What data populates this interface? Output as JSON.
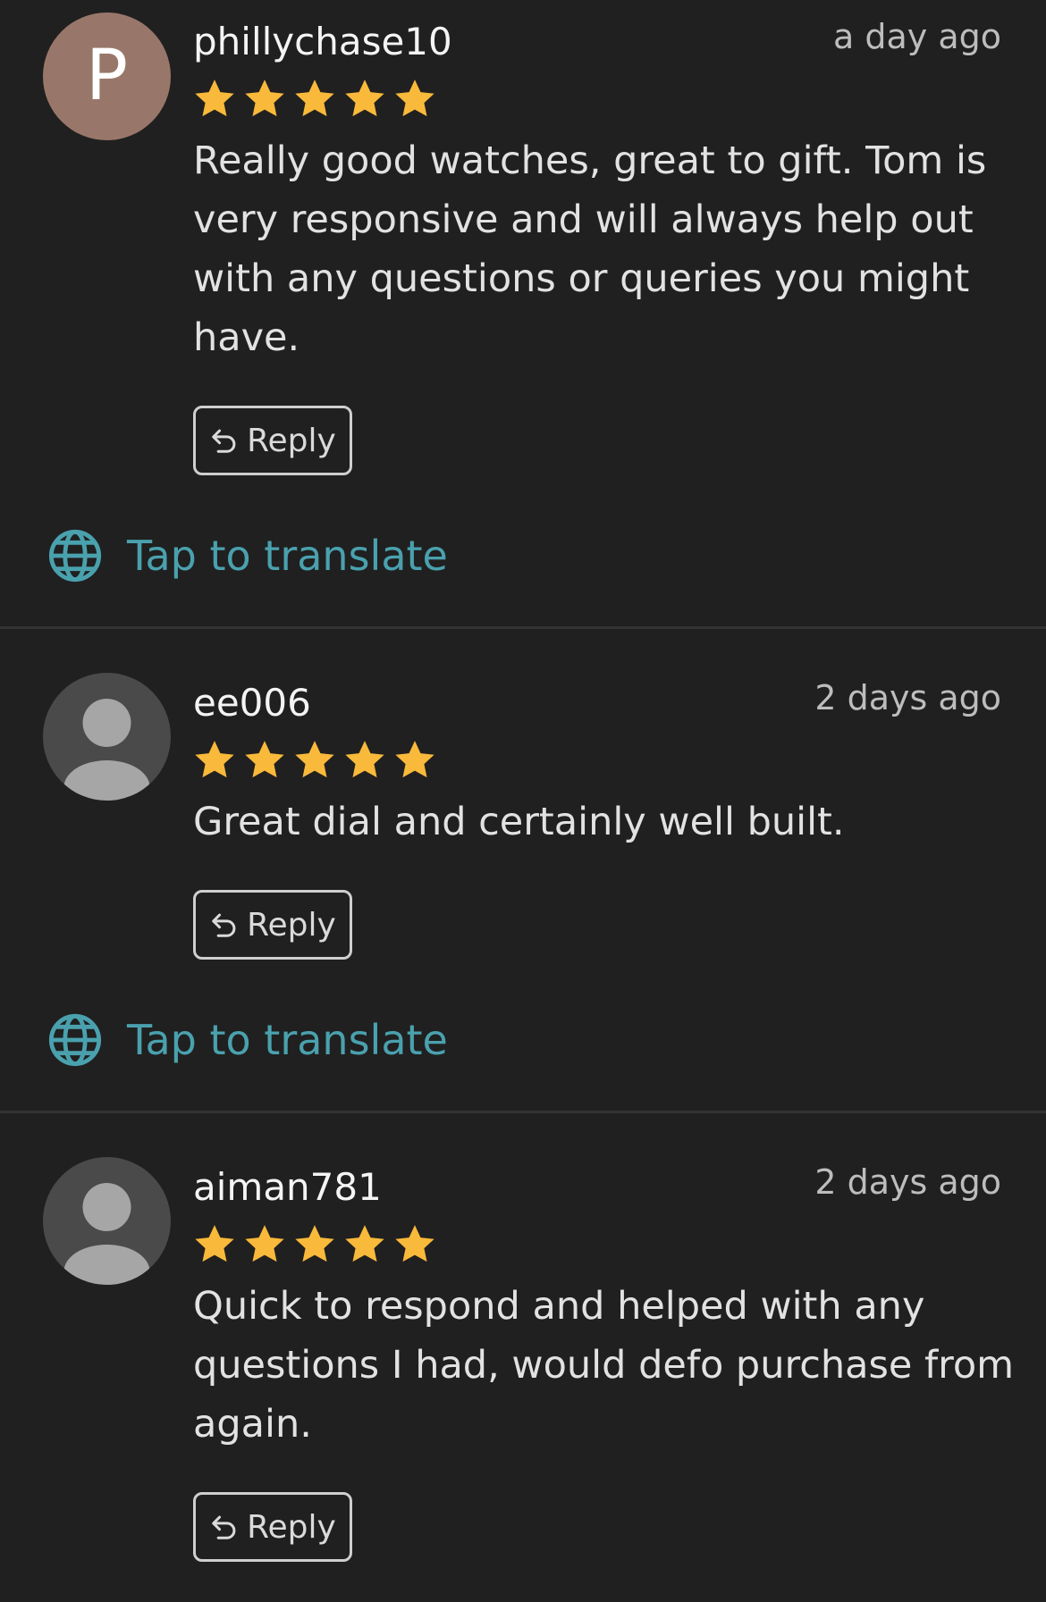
{
  "reviews": [
    {
      "username": "phillychase10",
      "time": "a day ago",
      "avatar_letter": "P",
      "rating": 5,
      "text": "Really good watches, great to gift. Tom is very responsive and will always help out with any questions or queries you might have.",
      "reply_label": "Reply",
      "translate_label": "Tap to translate"
    },
    {
      "username": "ee006",
      "time": "2 days ago",
      "rating": 5,
      "text": "Great dial and certainly well built.",
      "reply_label": "Reply",
      "translate_label": "Tap to translate"
    },
    {
      "username": "aiman781",
      "time": "2 days ago",
      "rating": 5,
      "text": "Quick to respond and helped with any questions I had, would defo purchase from again.",
      "reply_label": "Reply"
    }
  ],
  "colors": {
    "background": "#202020",
    "star": "#f9b93a",
    "translate": "#4aa1ae",
    "avatar_letter_bg": "#98776a",
    "avatar_default_bg": "#4a4a4a"
  },
  "icons": {
    "star": "star-icon",
    "reply": "reply-arrow-icon",
    "translate": "globe-icon",
    "default_avatar": "person-icon"
  }
}
